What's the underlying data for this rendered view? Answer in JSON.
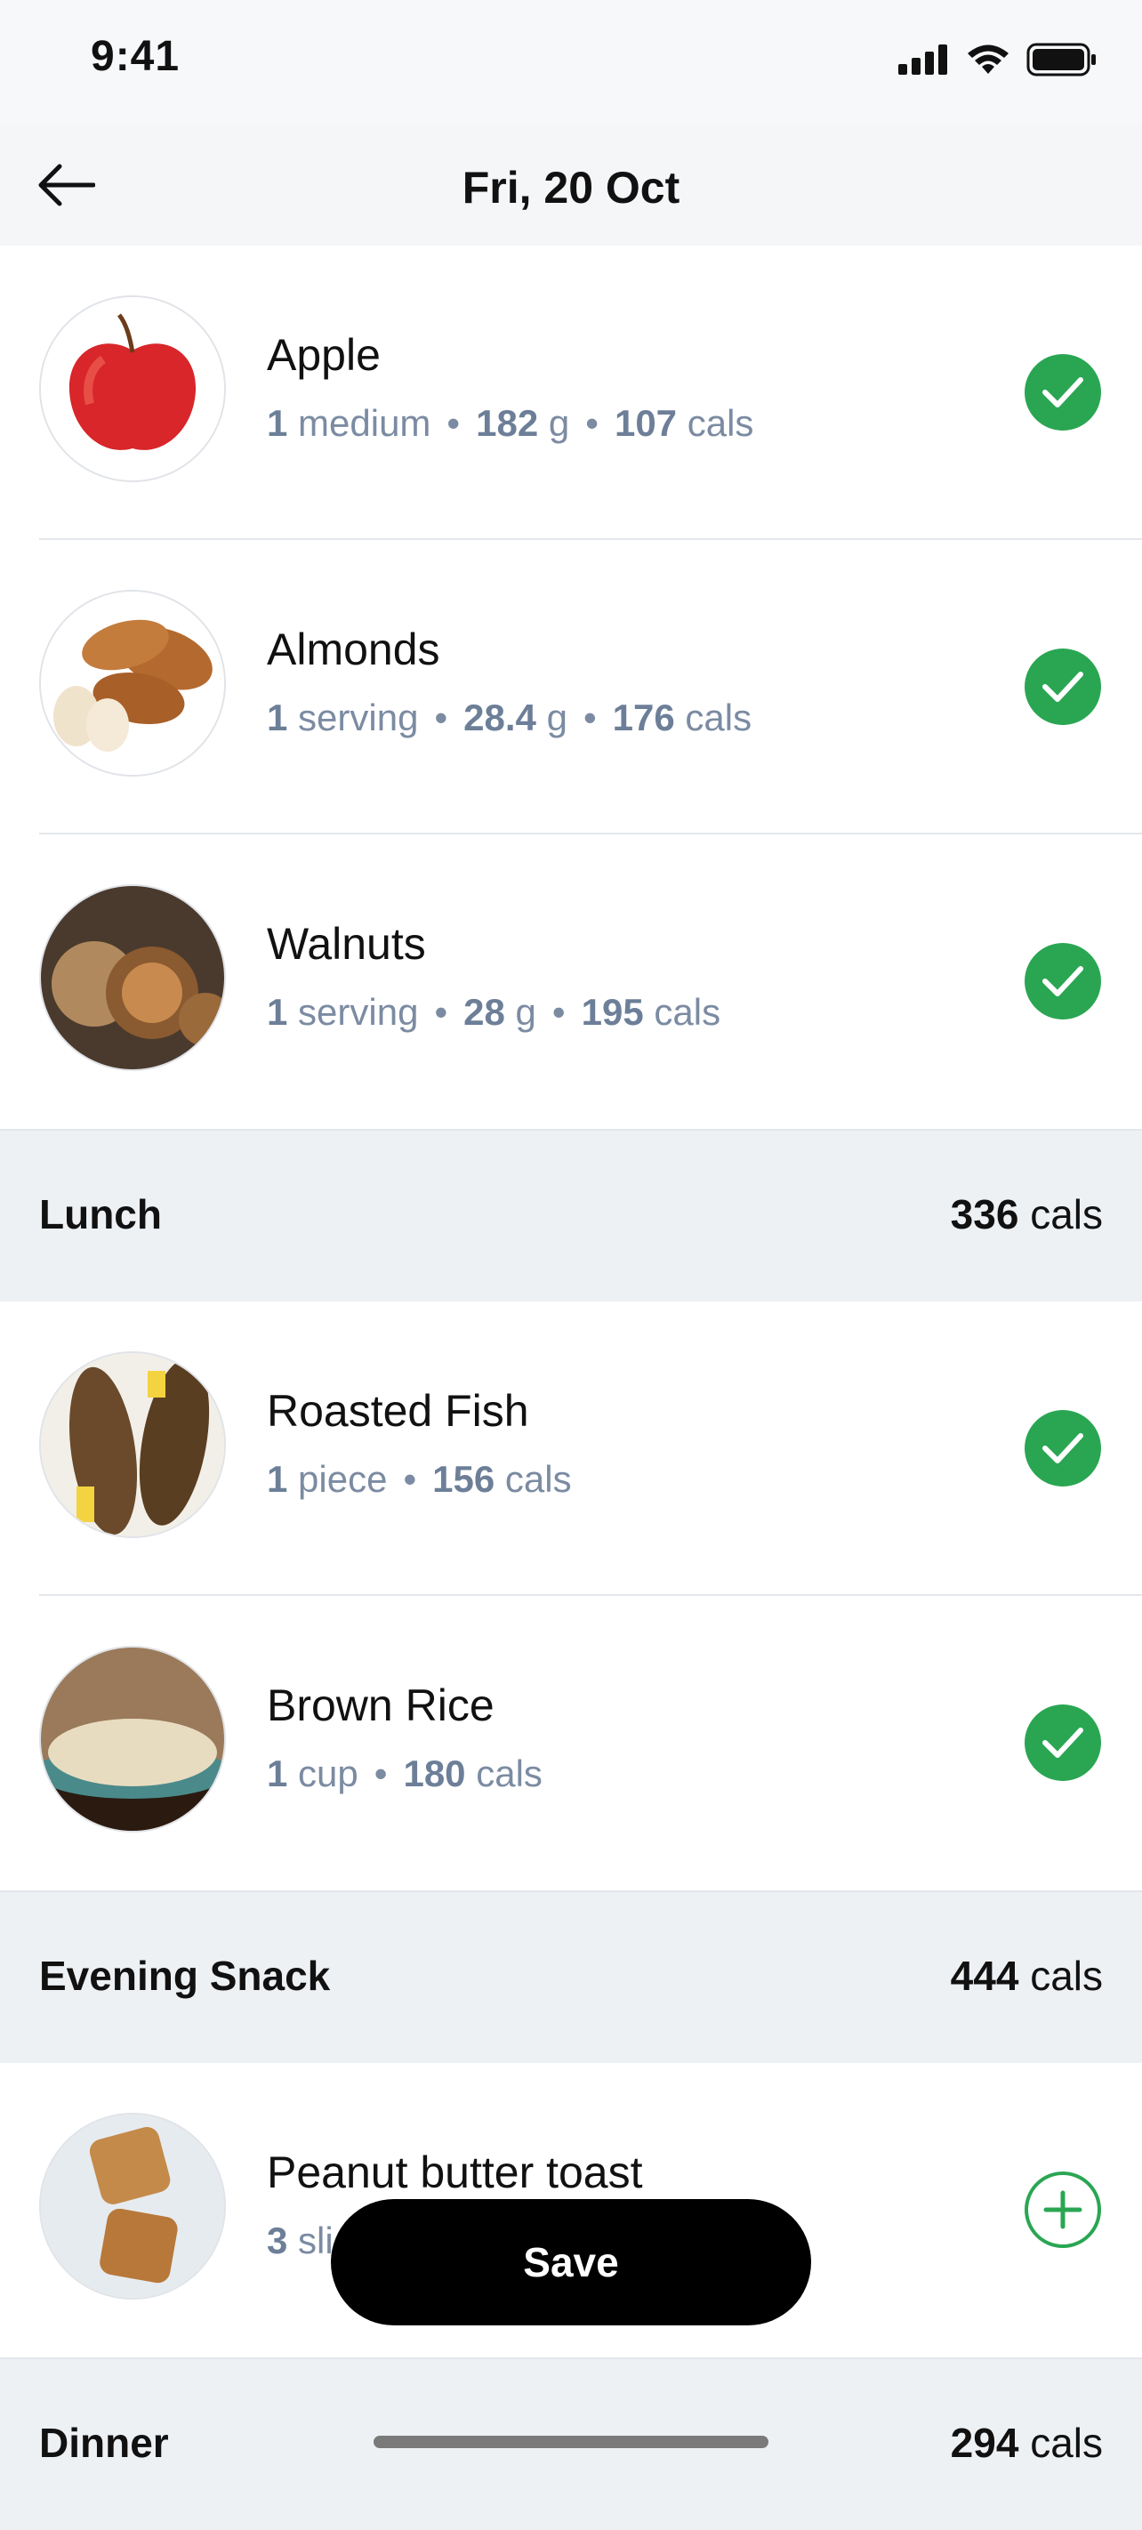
{
  "status": {
    "time": "9:41"
  },
  "header": {
    "title": "Fri, 20 Oct"
  },
  "items": [
    {
      "name": "Apple",
      "qty": "1",
      "unit": "medium",
      "weight": "182",
      "weight_unit": "g",
      "cals": "107",
      "cals_unit": "cals",
      "action": "check"
    },
    {
      "name": "Almonds",
      "qty": "1",
      "unit": "serving",
      "weight": "28.4",
      "weight_unit": "g",
      "cals": "176",
      "cals_unit": "cals",
      "action": "check"
    },
    {
      "name": "Walnuts",
      "qty": "1",
      "unit": "serving",
      "weight": "28",
      "weight_unit": "g",
      "cals": "195",
      "cals_unit": "cals",
      "action": "check"
    }
  ],
  "sections": [
    {
      "label": "Lunch",
      "cals": "336",
      "cals_unit": "cals",
      "items": [
        {
          "name": "Roasted Fish",
          "qty": "1",
          "unit": "piece",
          "cals": "156",
          "cals_unit": "cals",
          "action": "check"
        },
        {
          "name": "Brown Rice",
          "qty": "1",
          "unit": "cup",
          "cals": "180",
          "cals_unit": "cals",
          "action": "check"
        }
      ]
    },
    {
      "label": "Evening Snack",
      "cals": "444",
      "cals_unit": "cals",
      "items": [
        {
          "name": "Peanut butter toast",
          "qty": "3",
          "unit": "sli",
          "action": "add"
        }
      ]
    },
    {
      "label": "Dinner",
      "cals": "294",
      "cals_unit": "cals"
    }
  ],
  "save_label": "Save",
  "colors": {
    "accent": "#2aa653",
    "meta": "#7b8ba2",
    "section_bg": "#eef1f4"
  }
}
